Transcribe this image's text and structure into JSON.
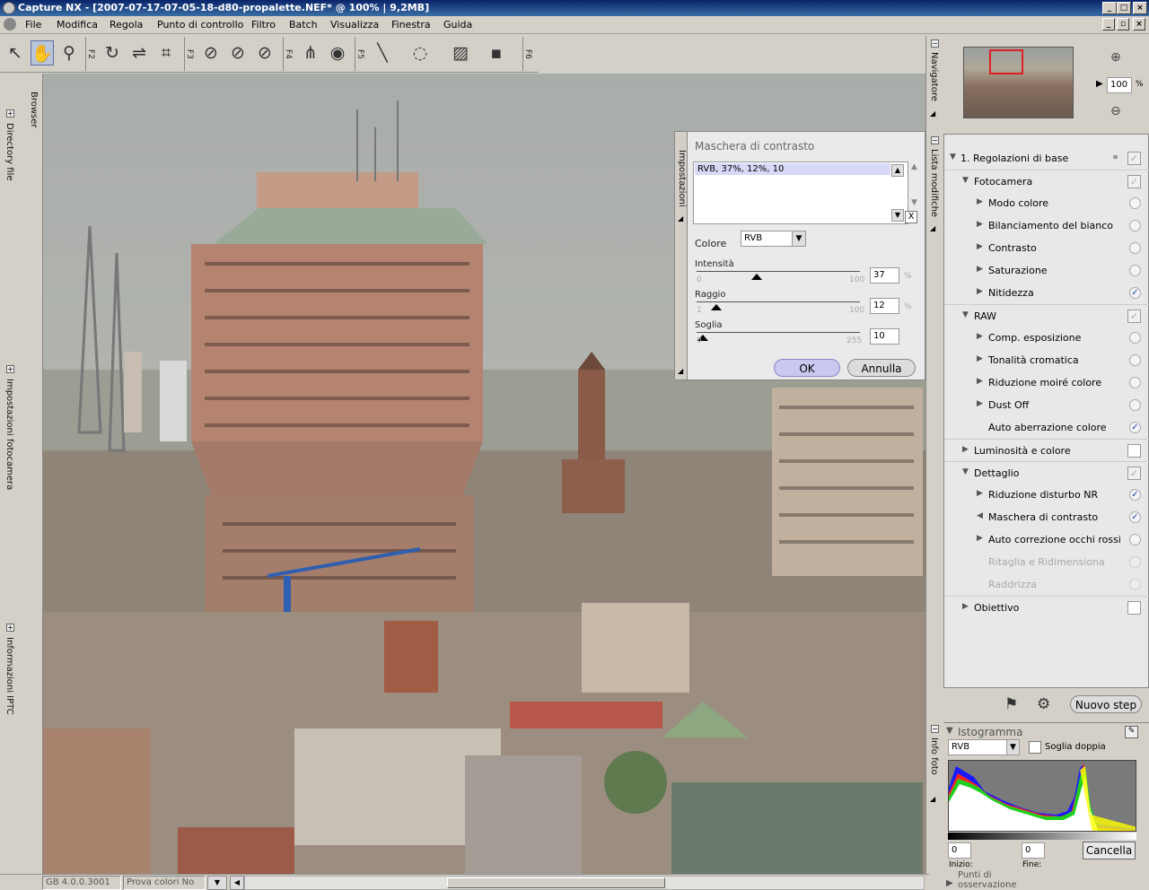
{
  "window": {
    "title": "Capture NX - [2007-07-17-07-05-18-d80-propalette.NEF* @ 100% | 9,2MB]"
  },
  "menu": [
    "File",
    "Modifica",
    "Regola",
    "Punto di controllo",
    "Filtro",
    "Batch",
    "Visualizza",
    "Finestra",
    "Guida"
  ],
  "toolbar": {
    "fkeys": [
      "F2",
      "F3",
      "F4",
      "F5",
      "F6"
    ]
  },
  "left_tabs": {
    "browser": "Browser",
    "directory": "Directory file",
    "camera": "Impostazioni fotocamera",
    "iptc": "Informazioni IPTC"
  },
  "right_tabs": {
    "navigator": "Navigatore",
    "edit_list": "Lista modifiche",
    "info": "Info foto"
  },
  "navigator": {
    "zoom": "100",
    "unit": "%"
  },
  "dialog": {
    "title": "Maschera di contrasto",
    "tab": "Impostazioni",
    "list_item": "RVB, 37%, 12%, 10",
    "colore_label": "Colore",
    "colore_value": "RVB",
    "intensita": {
      "label": "Intensità",
      "min": "0",
      "max": "100",
      "value": "37",
      "unit": "%",
      "fraction": 0.37
    },
    "raggio": {
      "label": "Raggio",
      "min": "1",
      "max": "100",
      "value": "12",
      "unit": "%",
      "fraction": 0.12
    },
    "soglia": {
      "label": "Soglia",
      "min": "0",
      "max": "255",
      "value": "10",
      "fraction": 0.04
    },
    "ok": "OK",
    "cancel": "Annulla"
  },
  "edit_list": {
    "step_title": "1. Regolazioni di base",
    "rows": [
      {
        "label": "Fotocamera",
        "level": 1,
        "kind": "checkbox",
        "checked": true,
        "open": true
      },
      {
        "label": "Modo colore",
        "level": 2,
        "kind": "radio",
        "checked": false
      },
      {
        "label": "Bilanciamento del bianco",
        "level": 2,
        "kind": "radio",
        "checked": false
      },
      {
        "label": "Contrasto",
        "level": 2,
        "kind": "radio",
        "checked": false
      },
      {
        "label": "Saturazione",
        "level": 2,
        "kind": "radio",
        "checked": false
      },
      {
        "label": "Nitidezza",
        "level": 2,
        "kind": "radio",
        "checked": true
      },
      {
        "label": "RAW",
        "level": 1,
        "kind": "checkbox",
        "checked": true,
        "open": true
      },
      {
        "label": "Comp. esposizione",
        "level": 2,
        "kind": "radio",
        "checked": false
      },
      {
        "label": "Tonalità cromatica",
        "level": 2,
        "kind": "radio",
        "checked": false
      },
      {
        "label": "Riduzione moiré colore",
        "level": 2,
        "kind": "radio",
        "checked": false
      },
      {
        "label": "Dust Off",
        "level": 2,
        "kind": "radio",
        "checked": false
      },
      {
        "label": "Auto aberrazione colore",
        "level": 2,
        "kind": "radio",
        "checked": true,
        "noarrow": true
      },
      {
        "label": "Luminosità e colore",
        "level": 1,
        "kind": "checkbox",
        "checked": false,
        "open": false
      },
      {
        "label": "Dettaglio",
        "level": 1,
        "kind": "checkbox",
        "checked": true,
        "open": true
      },
      {
        "label": "Riduzione disturbo NR",
        "level": 2,
        "kind": "radio",
        "checked": true
      },
      {
        "label": "Maschera di contrasto",
        "level": 2,
        "kind": "radio",
        "checked": true,
        "active": true
      },
      {
        "label": "Auto correzione occhi rossi",
        "level": 2,
        "kind": "radio",
        "checked": false
      },
      {
        "label": "Ritaglia e Ridimensiona",
        "level": 2,
        "kind": "radio",
        "checked": false,
        "disabled": true,
        "noarrow": true
      },
      {
        "label": "Raddrizza",
        "level": 2,
        "kind": "radio",
        "checked": false,
        "disabled": true,
        "noarrow": true
      },
      {
        "label": "Obiettivo",
        "level": 1,
        "kind": "checkbox",
        "checked": false,
        "open": false
      }
    ],
    "new_step": "Nuovo step"
  },
  "histogram": {
    "title": "Istogramma",
    "channel": "RVB",
    "dual_threshold": "Soglia doppia",
    "start_label": "Inizio:",
    "start_value": "0",
    "end_label": "Fine:",
    "end_value": "0",
    "cancel": "Cancella",
    "next_panel": "Punti di osservazione"
  },
  "status": {
    "version": "GB 4.0.0.3001",
    "proof": "Prova colori No"
  },
  "colors": {
    "title_bg": "#0a246a",
    "accent": "#1d3fbf",
    "ok_btn": "#c8c8f0"
  }
}
